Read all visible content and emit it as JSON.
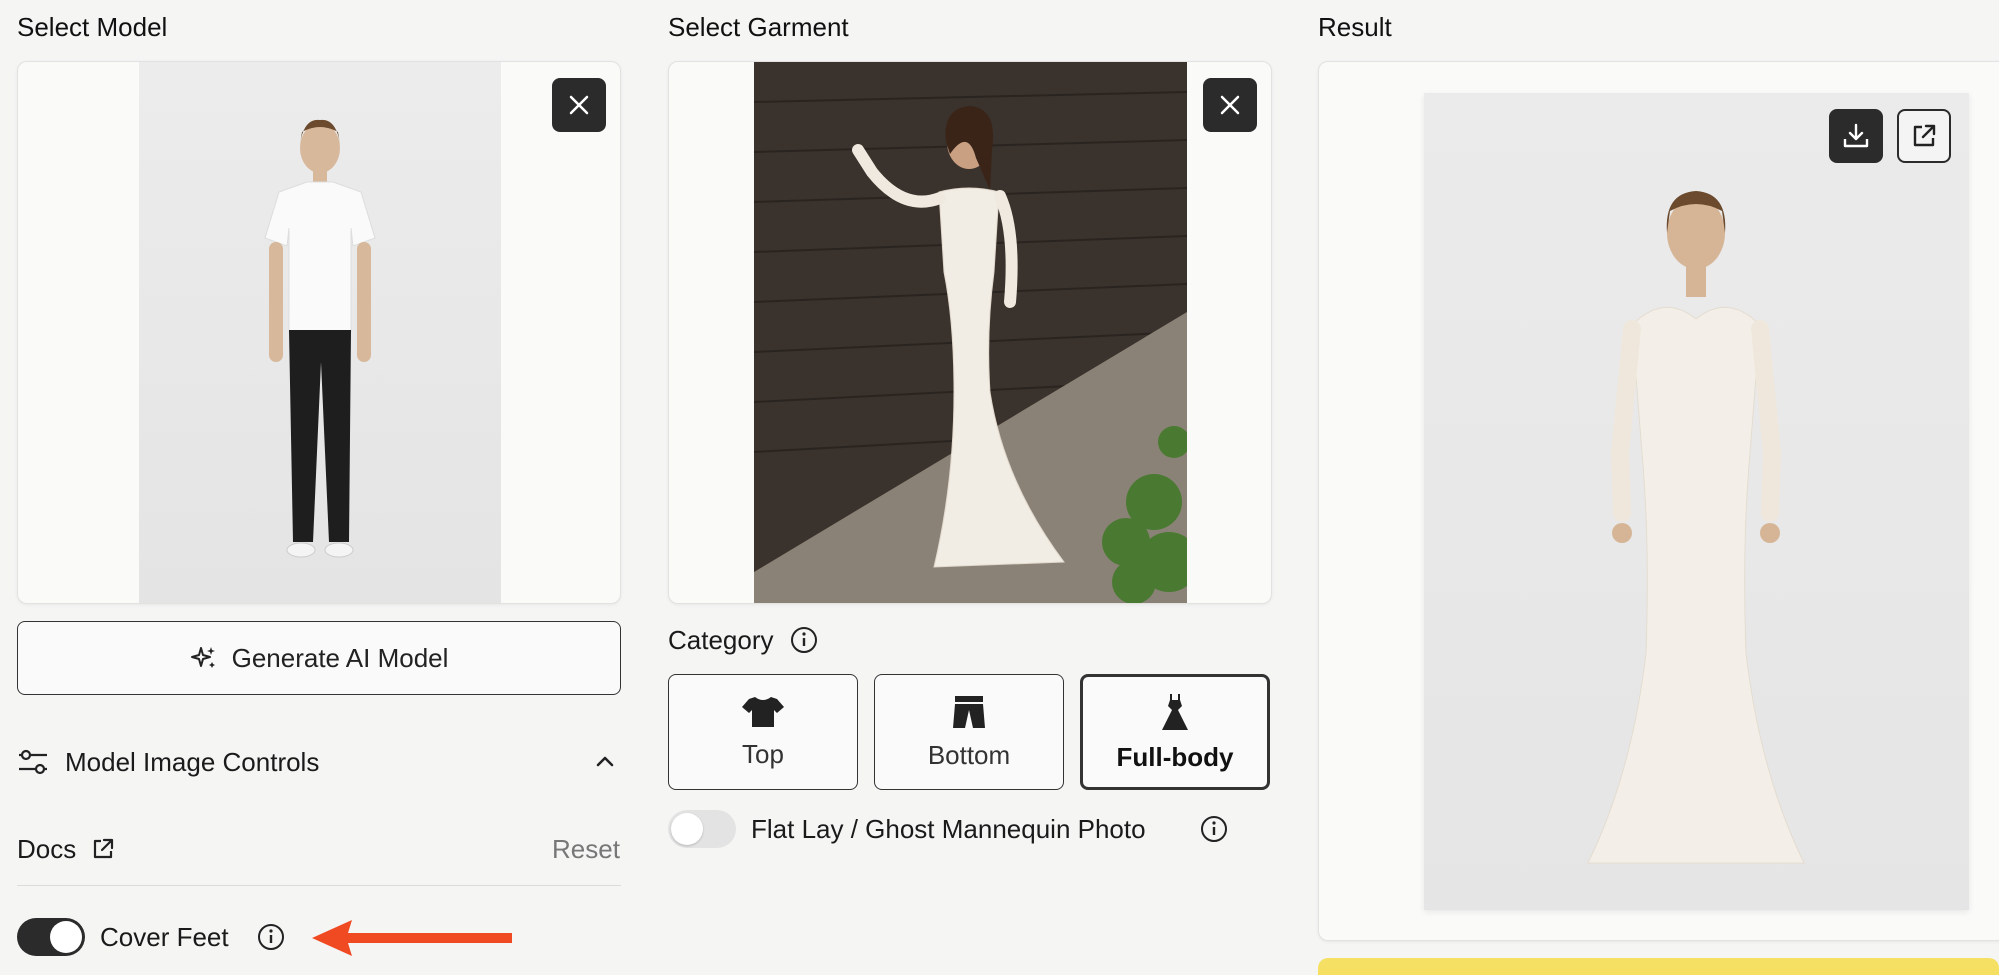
{
  "columns": {
    "model_title": "Select Model",
    "garment_title": "Select Garment",
    "result_title": "Result"
  },
  "model": {
    "generate_label": "Generate AI Model",
    "controls_label": "Model Image Controls",
    "docs_label": "Docs",
    "reset_label": "Reset",
    "cover_feet_label": "Cover Feet",
    "cover_feet_on": true
  },
  "garment": {
    "category_label": "Category",
    "categories": [
      {
        "label": "Top",
        "icon": "tshirt-icon",
        "selected": false
      },
      {
        "label": "Bottom",
        "icon": "pants-icon",
        "selected": false
      },
      {
        "label": "Full-body",
        "icon": "dress-icon",
        "selected": true
      }
    ],
    "flat_lay_label": "Flat Lay / Ghost Mannequin Photo",
    "flat_lay_on": false
  },
  "colors": {
    "accent_dark": "#2b2b2b",
    "arrow_red": "#f04a23",
    "yellow_bar": "#f5e063"
  }
}
